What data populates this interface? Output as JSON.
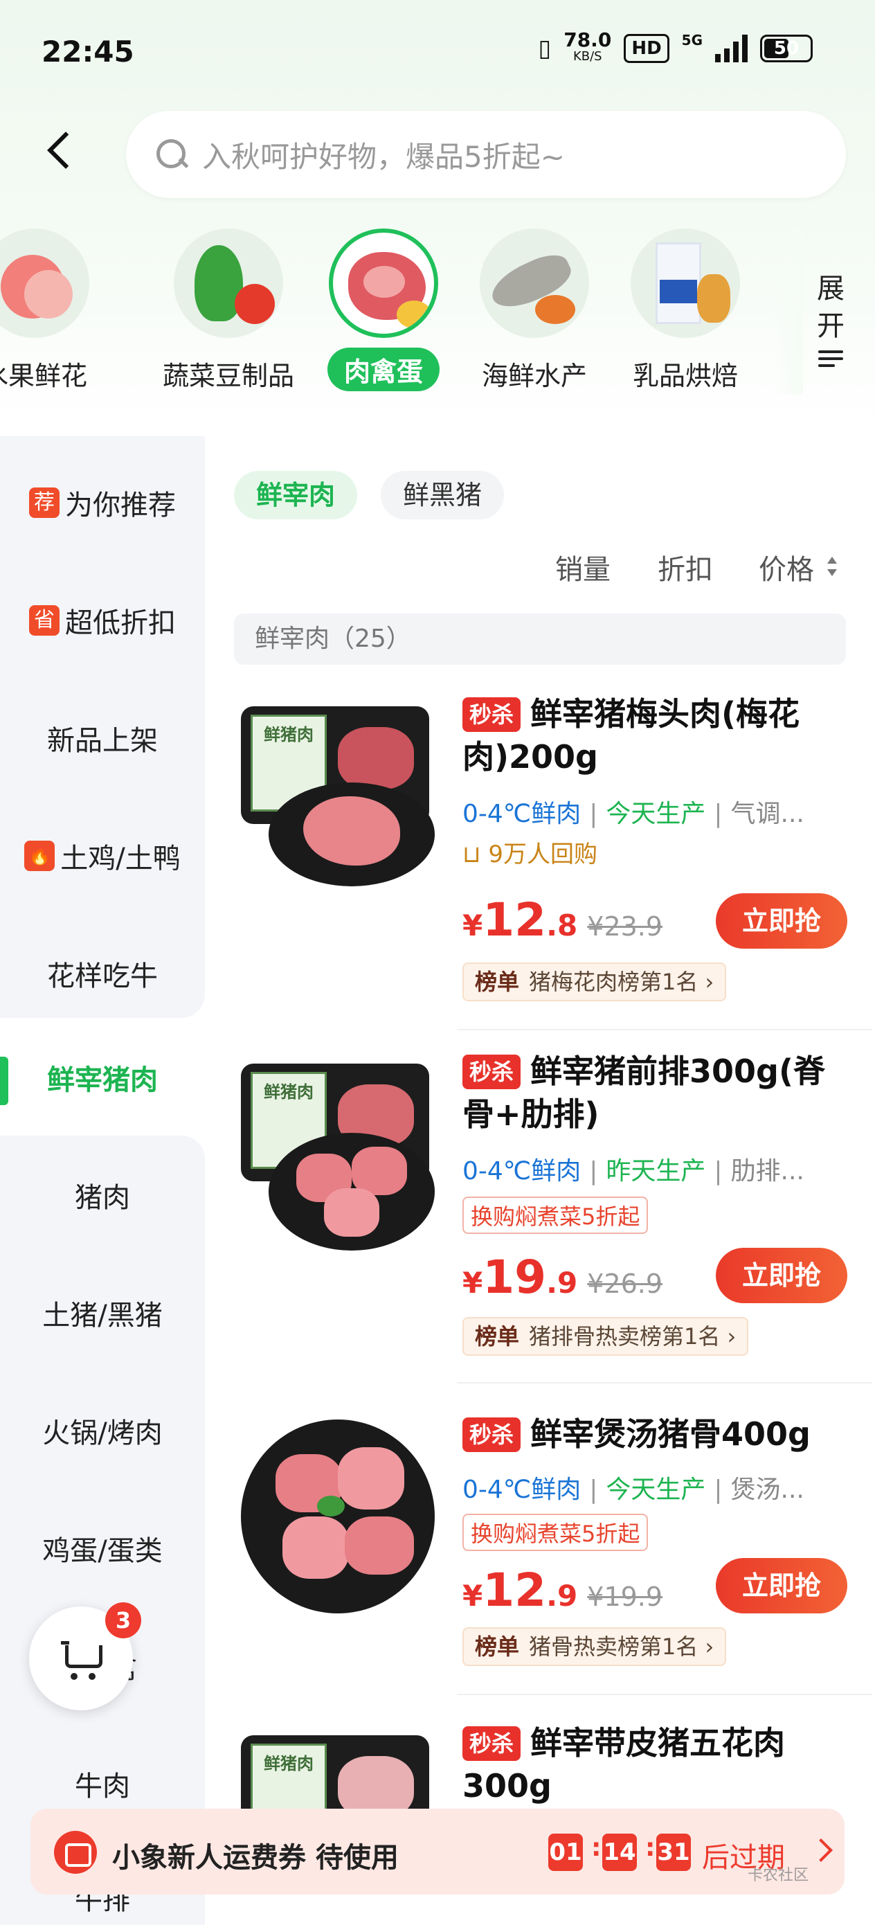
{
  "status_bar": {
    "time": "22:45",
    "net_speed": "78.0",
    "net_unit": "KB/S",
    "hd": "HD",
    "signal": "5G",
    "battery": "50"
  },
  "search": {
    "placeholder": "入秋呵护好物，爆品5折起~"
  },
  "categories": [
    {
      "label": "水果鲜花",
      "icon": "fruit-icon"
    },
    {
      "label": "蔬菜豆制品",
      "icon": "vegetable-icon"
    },
    {
      "label": "肉禽蛋",
      "icon": "meat-icon",
      "selected": true
    },
    {
      "label": "海鲜水产",
      "icon": "seafood-icon"
    },
    {
      "label": "乳品烘焙",
      "icon": "dairy-icon"
    }
  ],
  "expand": {
    "label_1": "展",
    "label_2": "开"
  },
  "sidebar": {
    "items": [
      {
        "label": "为你推荐",
        "tag": "荐"
      },
      {
        "label": "超低折扣",
        "tag": "省"
      },
      {
        "label": "新品上架"
      },
      {
        "label": "土鸡/土鸭",
        "tag": "🔥"
      },
      {
        "label": "花样吃牛"
      },
      {
        "label": "鲜宰猪肉",
        "selected": true
      },
      {
        "label": "猪肉"
      },
      {
        "label": "土猪/黑猪"
      },
      {
        "label": "火锅/烤肉"
      },
      {
        "label": "鸡蛋/蛋类"
      },
      {
        "label": "禽"
      },
      {
        "label": "牛肉"
      },
      {
        "label": "牛排"
      }
    ]
  },
  "chips": [
    {
      "label": "鲜宰肉",
      "selected": true
    },
    {
      "label": "鲜黑猪"
    }
  ],
  "sort": {
    "sales": "销量",
    "discount": "折扣",
    "price": "价格"
  },
  "section": {
    "title": "鲜宰肉（25）"
  },
  "products": [
    {
      "tag": "秒杀",
      "title": "鲜宰猪梅头肉(梅花肉)200g",
      "feat1": "0-4℃鲜肉",
      "feat2": "今天生产",
      "feat3": "气调...",
      "rebuy": "9万人回购",
      "promo": "",
      "price_cur": "¥",
      "price_int": "12",
      "price_dec": ".8",
      "orig": "¥23.9",
      "buy": "立即抢",
      "rank_tag": "榜单",
      "rank": "猪梅花肉榜第1名 ›",
      "img_label": "鲜猪肉"
    },
    {
      "tag": "秒杀",
      "title": "鲜宰猪前排300g(脊骨+肋排)",
      "feat1": "0-4℃鲜肉",
      "feat2": "昨天生产",
      "feat3": "肋排...",
      "rebuy": "",
      "promo": "换购焖煮菜5折起",
      "price_cur": "¥",
      "price_int": "19",
      "price_dec": ".9",
      "orig": "¥26.9",
      "buy": "立即抢",
      "rank_tag": "榜单",
      "rank": "猪排骨热卖榜第1名 ›",
      "img_label": "鲜猪肉"
    },
    {
      "tag": "秒杀",
      "title": "鲜宰煲汤猪骨400g",
      "feat1": "0-4℃鲜肉",
      "feat2": "今天生产",
      "feat3": "煲汤...",
      "rebuy": "",
      "promo": "换购焖煮菜5折起",
      "price_cur": "¥",
      "price_int": "12",
      "price_dec": ".9",
      "orig": "¥19.9",
      "buy": "立即抢",
      "rank_tag": "榜单",
      "rank": "猪骨热卖榜第1名 ›"
    },
    {
      "tag": "秒杀",
      "title": "鲜宰带皮猪五花肉300g",
      "img_label": "鲜猪肉"
    }
  ],
  "cart": {
    "count": "3"
  },
  "coupon": {
    "text": "小象新人运费券 待使用",
    "h": "01",
    "m": "14",
    "s": "31",
    "expire": "后过期"
  },
  "watermark": "卡农社区"
}
